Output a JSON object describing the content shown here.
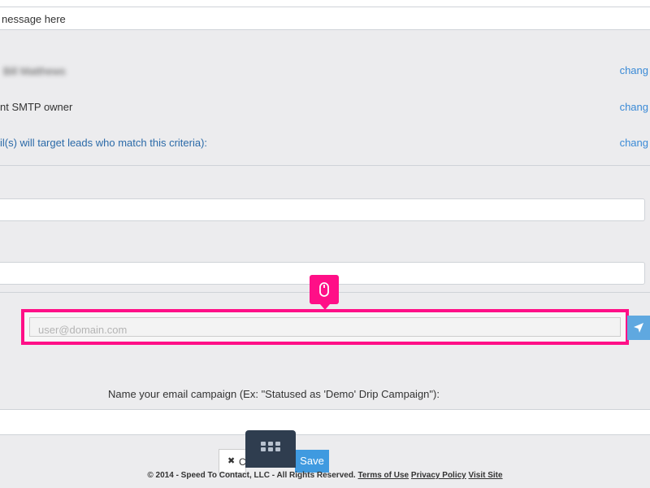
{
  "message_placeholder": "nessage here",
  "settings": {
    "from_value": "Bill Matthews",
    "smtp_text": "nt SMTP owner",
    "criteria_text": "il(s) will target leads who match this criteria):",
    "change_label": "chang"
  },
  "test_email": {
    "placeholder": "user@domain.com"
  },
  "campaign": {
    "label": "Name your email campaign (Ex: \"Statused as 'Demo' Drip Campaign\"):"
  },
  "actions": {
    "cancel_label": "C",
    "save_label": "Save"
  },
  "footer": {
    "copyright": "© 2014 - Speed To Contact, LLC - All Rights Reserved.",
    "terms_label": "Terms of Use",
    "privacy_label": "Privacy Policy",
    "visit_label": "Visit Site"
  },
  "colors": {
    "highlight": "#ff0f87",
    "link": "#3a8ad6",
    "primary_button": "#3f9ae0",
    "toolbar": "#2f3d4f"
  }
}
